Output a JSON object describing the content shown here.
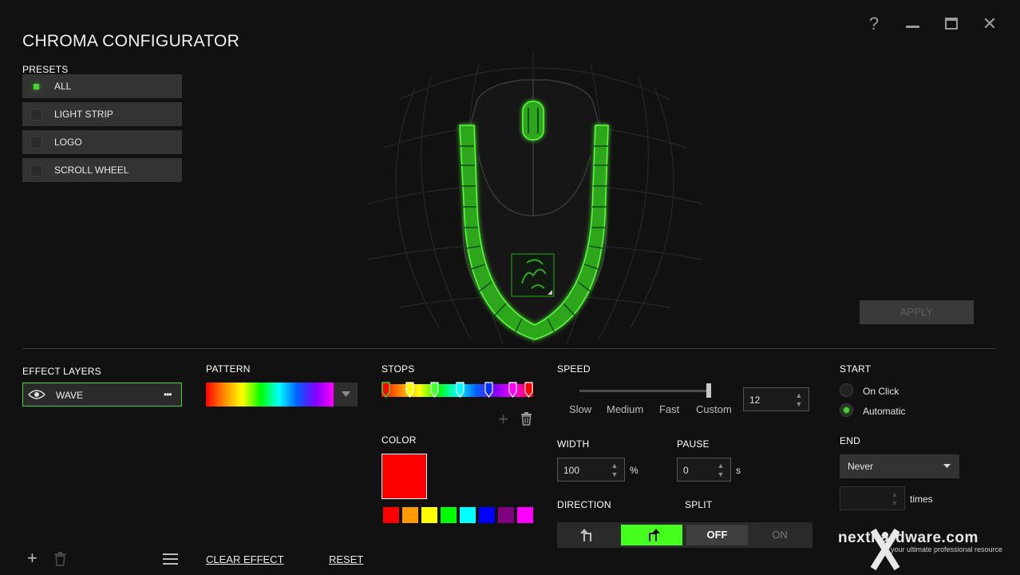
{
  "app": {
    "title": "CHROMA CONFIGURATOR"
  },
  "window_controls": {
    "help": "?",
    "minimize": "—",
    "maximize": "▭",
    "close": "✕"
  },
  "presets": {
    "label": "PRESETS",
    "items": [
      {
        "label": "ALL",
        "checked": true
      },
      {
        "label": "LIGHT STRIP",
        "checked": false
      },
      {
        "label": "LOGO",
        "checked": false
      },
      {
        "label": "SCROLL WHEEL",
        "checked": false
      }
    ]
  },
  "apply_label": "APPLY",
  "effect_layers": {
    "label": "EFFECT LAYERS",
    "layer_name": "WAVE",
    "menu": "•••"
  },
  "pattern": {
    "label": "PATTERN"
  },
  "stops": {
    "label": "STOPS",
    "colors": [
      "#ff0000",
      "#ffff00",
      "#44ff33",
      "#00ffff",
      "#0033ff",
      "#ff00ff",
      "#ff0000"
    ]
  },
  "color": {
    "label": "COLOR",
    "selected": "#ff0000",
    "swatches": [
      "#ff0000",
      "#ff9900",
      "#ffff00",
      "#00ff00",
      "#00ffff",
      "#0000ff",
      "#800080",
      "#ff00ff"
    ]
  },
  "speed": {
    "label": "SPEED",
    "options": [
      "Slow",
      "Medium",
      "Fast",
      "Custom"
    ],
    "selected": "Custom",
    "value": "12"
  },
  "width": {
    "label": "WIDTH",
    "value": "100",
    "unit": "%"
  },
  "pause": {
    "label": "PAUSE",
    "value": "0",
    "unit": "s"
  },
  "direction": {
    "label": "DIRECTION",
    "selected": 1
  },
  "split": {
    "label": "SPLIT",
    "off": "OFF",
    "on": "ON",
    "selected": "OFF"
  },
  "start": {
    "label": "START",
    "options": [
      {
        "label": "On Click",
        "selected": false
      },
      {
        "label": "Automatic",
        "selected": true
      }
    ]
  },
  "end": {
    "label": "END",
    "value": "Never",
    "times_value": "",
    "times_label": "times"
  },
  "bottom_actions": {
    "clear": "CLEAR EFFECT",
    "reset": "RESET"
  },
  "watermark": {
    "brand": "nexthardware.com",
    "tagline": "your ultimate professional resource"
  },
  "colors": {
    "accent": "#44d62c",
    "background": "#111111",
    "panel": "#333333"
  }
}
